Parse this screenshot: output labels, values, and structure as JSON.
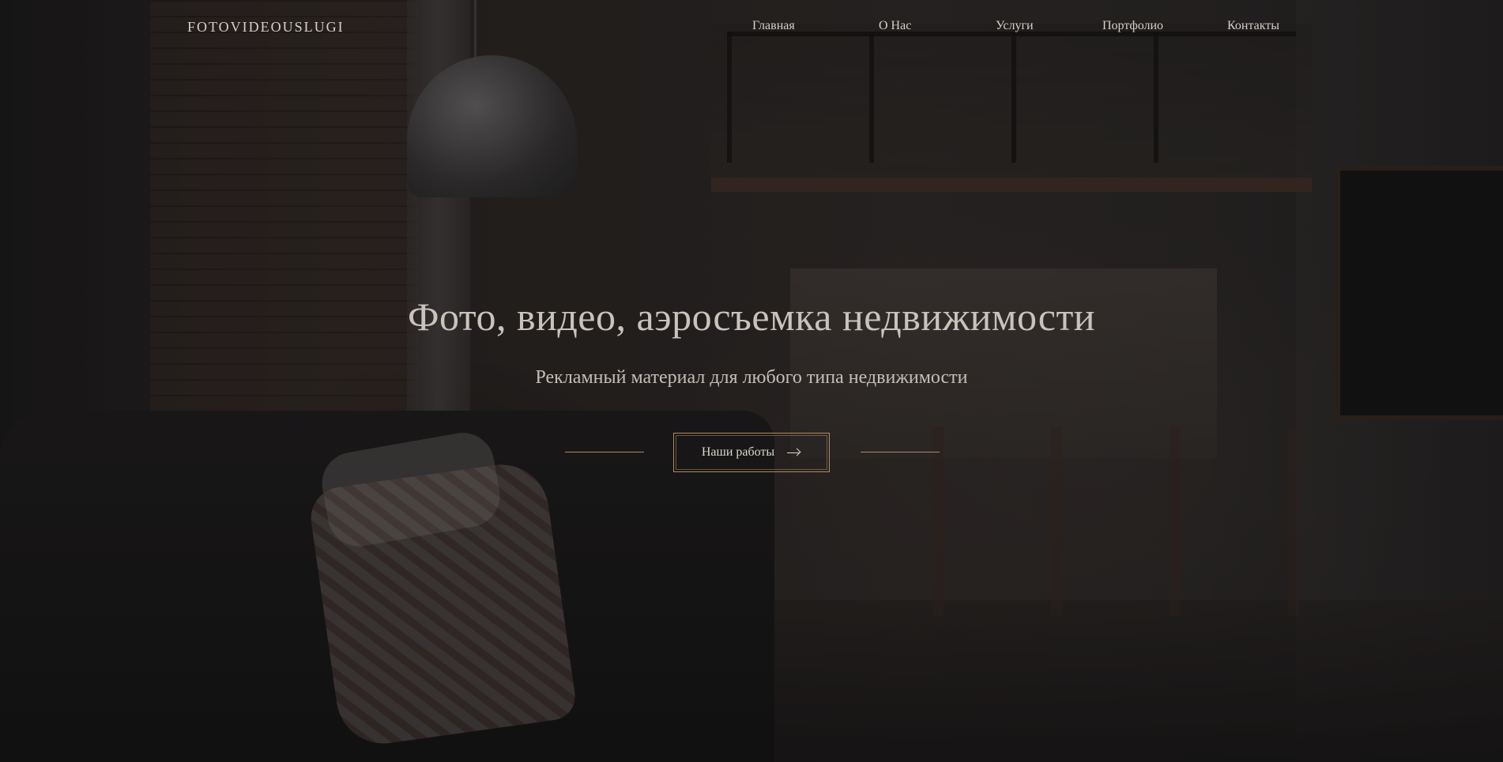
{
  "header": {
    "logo": "FOTOVIDEOUSLUGI",
    "nav": [
      {
        "label": "Главная"
      },
      {
        "label": "О Нас"
      },
      {
        "label": "Услуги"
      },
      {
        "label": "Портфолио"
      },
      {
        "label": "Контакты"
      }
    ]
  },
  "hero": {
    "title": "Фото, видео, аэросъемка недвижимости",
    "subtitle": "Рекламный материал для любого типа недвижимости",
    "cta_label": "Наши работы",
    "cta_icon": "arrow-right-icon"
  },
  "colors": {
    "accent": "#b08a62",
    "text": "#d6d0ca",
    "overlay": "#1c1a1a"
  }
}
